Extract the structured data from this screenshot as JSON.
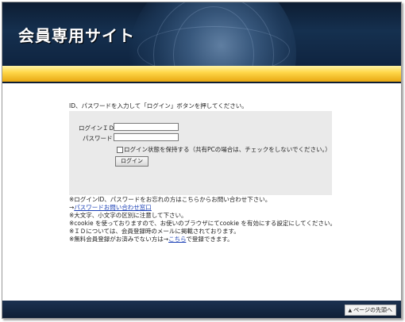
{
  "header": {
    "title": "会員専用サイト"
  },
  "login": {
    "instruction": "ID、パスワードを入力して「ログイン」ボタンを押してください。",
    "id_label": "ログインＩＤ",
    "password_label": "パスワード",
    "id_value": "",
    "password_value": "",
    "remember_label": "ログイン状態を保持する（共有PCの場合は、チェックをしないでください。）",
    "button_label": "ログイン"
  },
  "notes": {
    "line1": "※ログインID、パスワードをお忘れの方はこちらからお問い合わせ下さい。",
    "arrow": "→",
    "contact_link": "パスワードお問い合わせ窓口",
    "line3": "※大文字、小文字の区別に注意して下さい。",
    "line4": "※cookie を使っておりますので、お使いのブラウザにてcookie を有効にする設定にしてください。",
    "line5": "※ＩＤについては、会員登録時のメールに掲載されております。",
    "line6_prefix": "※無料会員登録がお済みでない方は→",
    "line6_link": "こちら",
    "line6_suffix": "で登録できます。"
  },
  "footer": {
    "page_top_label": "ページの先頭へ",
    "icon": "arrow-up-icon"
  }
}
